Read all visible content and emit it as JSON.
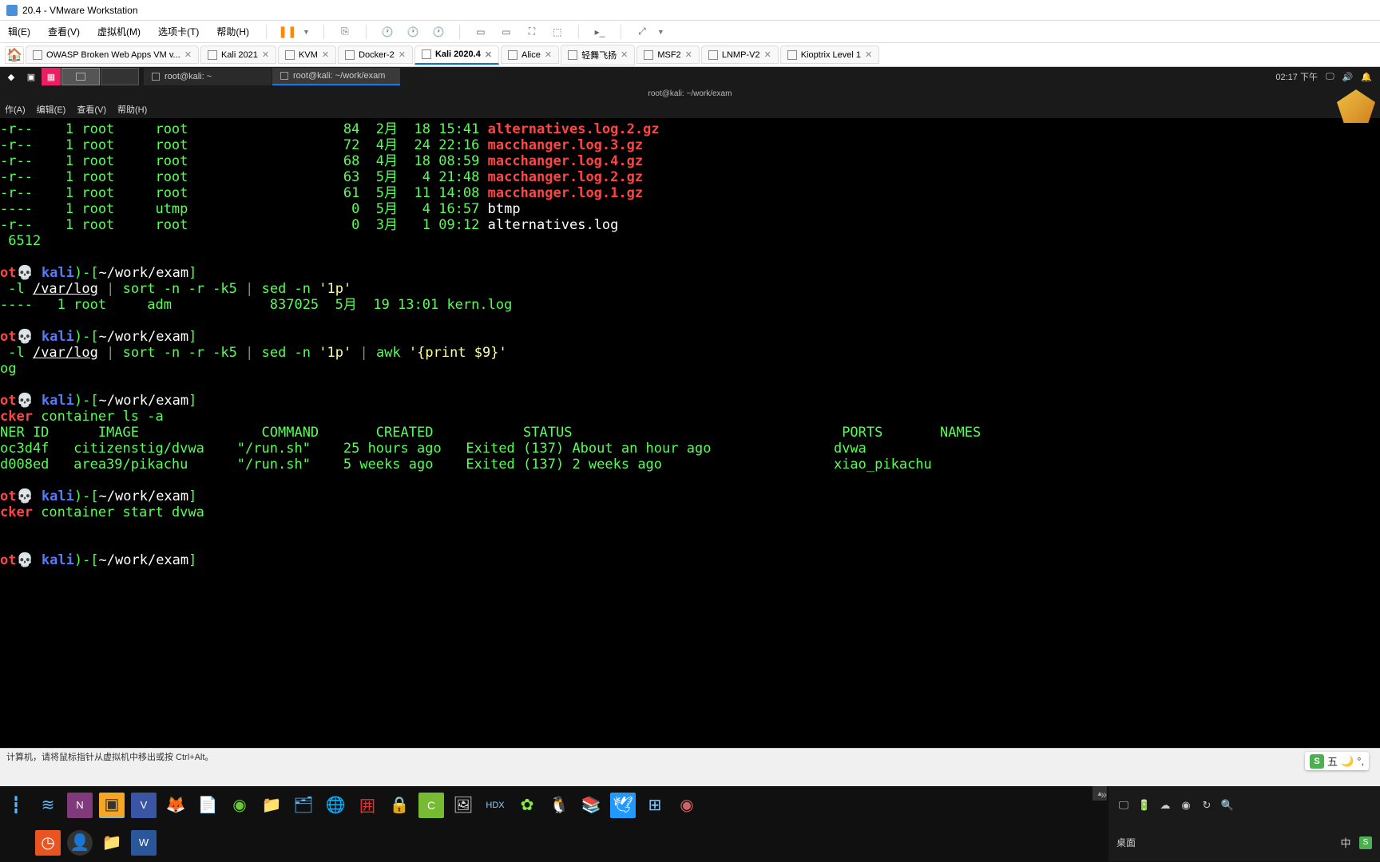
{
  "app": {
    "title": "20.4 - VMware Workstation"
  },
  "menubar": {
    "edit": "辑(E)",
    "view": "查看(V)",
    "vm": "虚拟机(M)",
    "tabs": "选项卡(T)",
    "help": "帮助(H)"
  },
  "vm_tabs": [
    {
      "label": "OWASP Broken Web Apps VM v...",
      "active": false
    },
    {
      "label": "Kali 2021",
      "active": false
    },
    {
      "label": "KVM",
      "active": false
    },
    {
      "label": "Docker-2",
      "active": false
    },
    {
      "label": "Kali 2020.4",
      "active": true
    },
    {
      "label": "Alice",
      "active": false
    },
    {
      "label": "轻舞飞扬",
      "active": false
    },
    {
      "label": "MSF2",
      "active": false
    },
    {
      "label": "LNMP-V2",
      "active": false
    },
    {
      "label": "Kioptrix Level 1",
      "active": false
    }
  ],
  "kali_windows": [
    {
      "label": "root@kali: ~",
      "active": false
    },
    {
      "label": "root@kali: ~/work/exam",
      "active": true
    }
  ],
  "kali_tray": {
    "time": "02:17 下午"
  },
  "terminal": {
    "title": "root@kali: ~/work/exam",
    "menu": {
      "file": "作(A)",
      "edit": "编辑(E)",
      "view": "查看(V)",
      "help": "帮助(H)"
    },
    "listing": [
      {
        "perm": "-r--",
        "links": "1",
        "owner": "root",
        "group": "root",
        "size": "84",
        "month": "2月",
        "day": "18",
        "time": "15:41",
        "name": "alternatives.log.2.gz"
      },
      {
        "perm": "-r--",
        "links": "1",
        "owner": "root",
        "group": "root",
        "size": "72",
        "month": "4月",
        "day": "24",
        "time": "22:16",
        "name": "macchanger.log.3.gz"
      },
      {
        "perm": "-r--",
        "links": "1",
        "owner": "root",
        "group": "root",
        "size": "68",
        "month": "4月",
        "day": "18",
        "time": "08:59",
        "name": "macchanger.log.4.gz"
      },
      {
        "perm": "-r--",
        "links": "1",
        "owner": "root",
        "group": "root",
        "size": "63",
        "month": "5月",
        "day": "4",
        "time": "21:48",
        "name": "macchanger.log.2.gz"
      },
      {
        "perm": "-r--",
        "links": "1",
        "owner": "root",
        "group": "root",
        "size": "61",
        "month": "5月",
        "day": "11",
        "time": "14:08",
        "name": "macchanger.log.1.gz"
      },
      {
        "perm": "----",
        "links": "1",
        "owner": "root",
        "group": "utmp",
        "size": "0",
        "month": "5月",
        "day": "4",
        "time": "16:57",
        "name": "btmp"
      },
      {
        "perm": "-r--",
        "links": "1",
        "owner": "root",
        "group": "root",
        "size": "0",
        "month": "3月",
        "day": "1",
        "time": "09:12",
        "name": "alternatives.log"
      }
    ],
    "total_end": " 6512",
    "prompts": {
      "user_prefix": "ot💀 ",
      "host": "kali",
      "path": "~/work/exam"
    },
    "cmd1_pre": " -l ",
    "varlog": "/var/log",
    "cmd1_mid": " | sort -n -r -k5 | sed -n ",
    "cmd1_arg": "'1p'",
    "cmd1_out": "----   1 root     adm            837025  5月  19 13:01 kern.log",
    "cmd2_pre": " -l ",
    "cmd2_mid": " | sort -n -r -k5 | sed -n ",
    "cmd2_arg1": "'1p'",
    "cmd2_mid2": " | awk ",
    "cmd2_arg2": "'{print $9}'",
    "cmd2_out": "og",
    "cmd3_pre": "cker",
    "cmd3_txt": " container ls -a",
    "docker_header": "NER ID      IMAGE               COMMAND       CREATED           STATUS                                 PORTS       NAMES",
    "docker_rows": [
      "oc3d4f   citizenstig/dvwa    \"/run.sh\"    25 hours ago   Exited (137) About an hour ago               dvwa",
      "d008ed   area39/pikachu      \"/run.sh\"    5 weeks ago    Exited (137) 2 weeks ago                     xiao_pikachu"
    ],
    "cmd4_pre": "cker",
    "cmd4_txt": " container start dvwa"
  },
  "statusbar": {
    "text": "计算机，请将鼠标指针从虚拟机中移出或按 Ctrl+Alt。"
  },
  "sogou": {
    "text": "五"
  },
  "desktop": {
    "label": "桌面",
    "ime": "中"
  }
}
